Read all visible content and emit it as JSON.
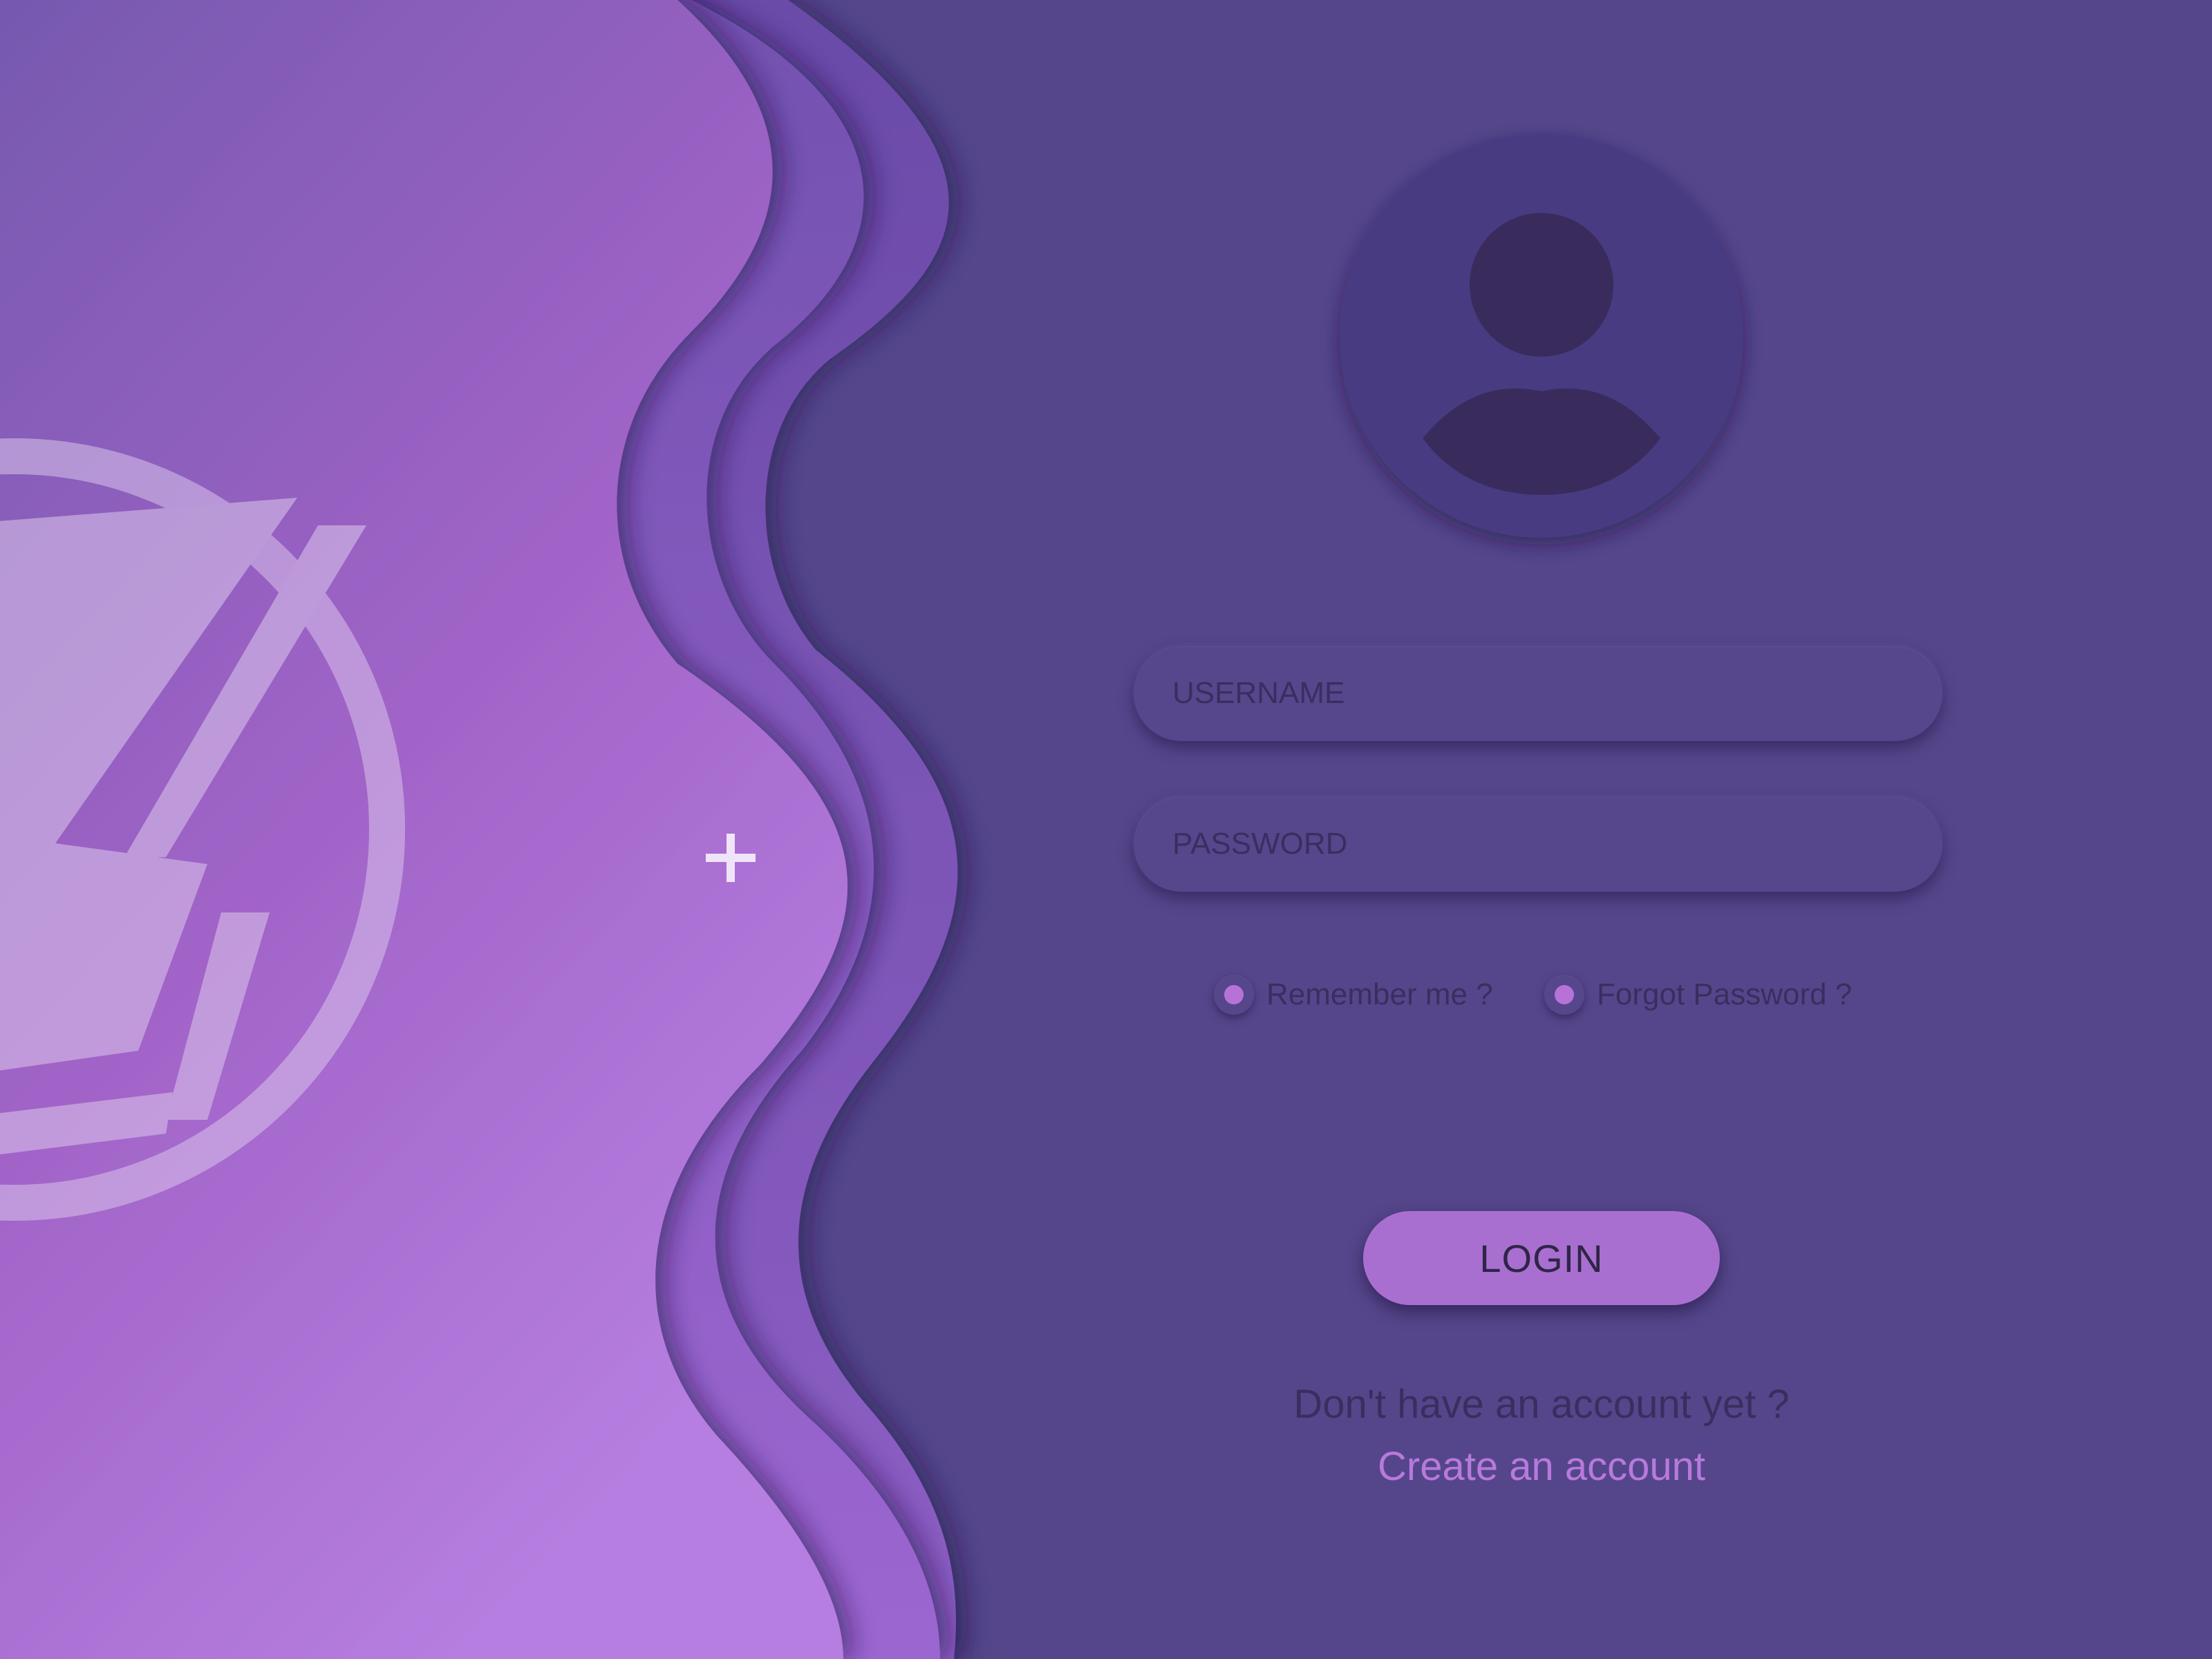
{
  "login_form": {
    "username_placeholder": "USERNAME",
    "password_placeholder": "PASSWORD",
    "remember_label": "Remember me ?",
    "forgot_label": "Forgot Password ?",
    "login_label": "LOGIN",
    "signup_prompt": "Don't have an account yet ?",
    "create_account_label": "Create an account"
  },
  "icons": {
    "avatar": "user-silhouette-icon",
    "logo": "lightning-bolt-logo",
    "cursor": "crosshair-plus-icon"
  },
  "colors": {
    "panel_background": "#55468b",
    "wave_gradient_start": "#7a5bb4",
    "wave_gradient_end": "#b47be0",
    "accent": "#b772d8",
    "button": "#a86fd0",
    "link": "#b879dc",
    "text_dark": "#3a2e60"
  }
}
